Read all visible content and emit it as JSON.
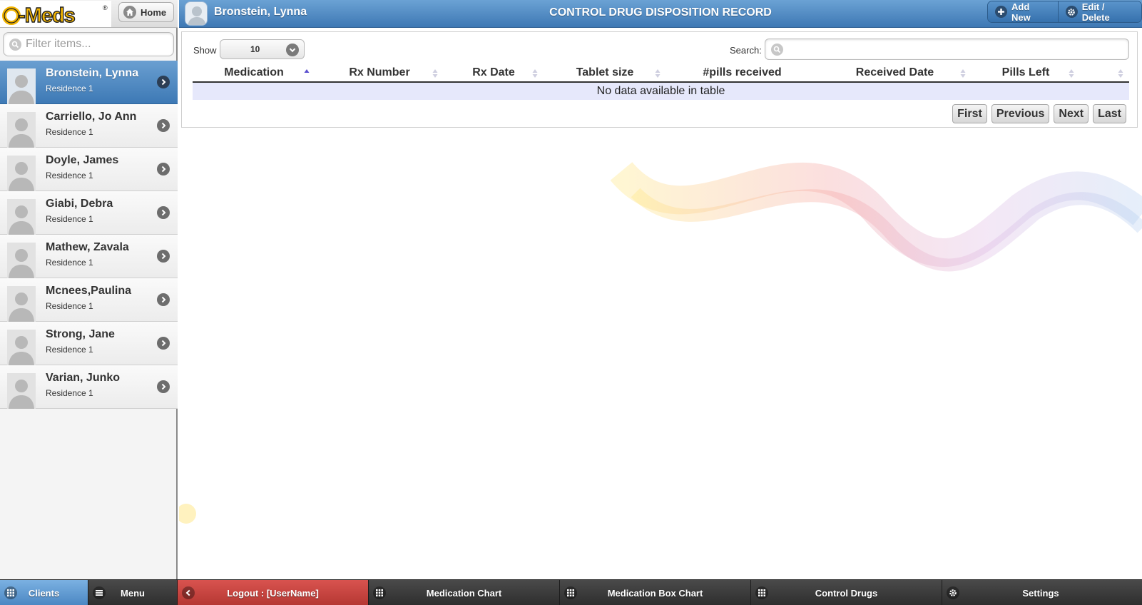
{
  "sidebar": {
    "logo_text": "O-Meds",
    "home_label": "Home",
    "filter_placeholder": "Filter items...",
    "clients": [
      {
        "name": "Bronstein, Lynna",
        "residence": "Residence 1"
      },
      {
        "name": "Carriello, Jo Ann",
        "residence": "Residence 1"
      },
      {
        "name": "Doyle, James",
        "residence": "Residence 1"
      },
      {
        "name": "Giabi, Debra",
        "residence": "Residence 1"
      },
      {
        "name": "Mathew, Zavala",
        "residence": "Residence 1"
      },
      {
        "name": "Mcnees,Paulina",
        "residence": "Residence 1"
      },
      {
        "name": "Strong, Jane",
        "residence": "Residence 1"
      },
      {
        "name": "Varian, Junko",
        "residence": "Residence 1"
      }
    ],
    "selected_index": 0
  },
  "header": {
    "client_name": "Bronstein, Lynna",
    "title": "CONTROL DRUG DISPOSITION RECORD",
    "add_new_label": "Add New",
    "edit_delete_label": "Edit / Delete"
  },
  "table": {
    "show_label": "Show",
    "page_length": "10",
    "search_label": "Search:",
    "search_value": "",
    "columns": [
      "Medication",
      "Rx Number",
      "Rx Date",
      "Tablet size",
      "#pills received",
      "Received Date",
      "Pills Left",
      ""
    ],
    "sorted_column": "Medication",
    "empty_message": "No data available in table",
    "pager": {
      "first": "First",
      "previous": "Previous",
      "next": "Next",
      "last": "Last"
    }
  },
  "bottom_nav": {
    "clients": "Clients",
    "menu": "Menu",
    "logout": "Logout : [UserName]",
    "medication_chart": "Medication Chart",
    "medication_box_chart": "Medication Box Chart",
    "control_drugs": "Control Drugs",
    "settings": "Settings"
  },
  "colors": {
    "header_blue": "#4a86c2",
    "active_row_blue": "#3d79b5",
    "logout_red": "#c9413c",
    "empty_row_lavender": "#e6e8fb"
  }
}
